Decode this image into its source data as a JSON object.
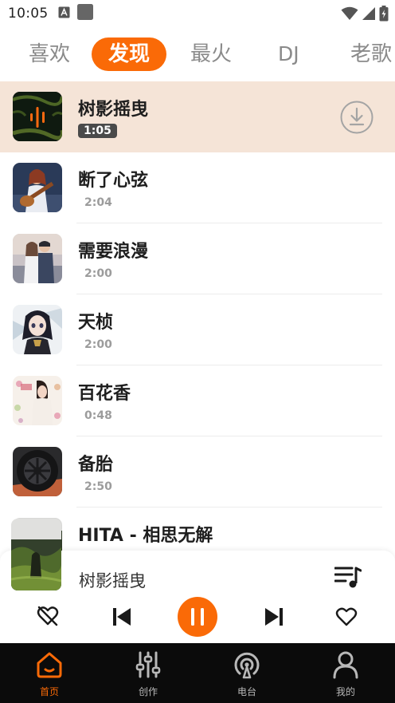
{
  "status": {
    "time": "10:05"
  },
  "tabs": [
    {
      "label": "喜欢",
      "active": false
    },
    {
      "label": "发现",
      "active": true
    },
    {
      "label": "最火",
      "active": false
    },
    {
      "label": "DJ",
      "active": false
    },
    {
      "label": "老歌",
      "active": false
    }
  ],
  "songs": [
    {
      "title": "树影摇曳",
      "duration": "1:05",
      "current": true,
      "cover_icon": "audio-wave-icon"
    },
    {
      "title": "断了心弦",
      "duration": "2:04",
      "current": false,
      "cover_icon": "guitar-girl-cover"
    },
    {
      "title": "需要浪漫",
      "duration": "2:00",
      "current": false,
      "cover_icon": "couple-cover"
    },
    {
      "title": "天桢",
      "duration": "2:00",
      "current": false,
      "cover_icon": "anime-girl-cover"
    },
    {
      "title": "百花香",
      "duration": "0:48",
      "current": false,
      "cover_icon": "flower-woman-cover"
    },
    {
      "title": "备胎",
      "duration": "2:50",
      "current": false,
      "cover_icon": "tire-cover"
    },
    {
      "title": "HITA - 相思无解",
      "duration": "",
      "current": false,
      "cover_icon": "forest-cover"
    }
  ],
  "player": {
    "title": "树影摇曳"
  },
  "nav": [
    {
      "label": "首页",
      "icon": "home-icon",
      "active": true
    },
    {
      "label": "创作",
      "icon": "sliders-icon",
      "active": false
    },
    {
      "label": "电台",
      "icon": "radio-icon",
      "active": false
    },
    {
      "label": "我的",
      "icon": "user-icon",
      "active": false
    }
  ],
  "colors": {
    "accent": "#fa6a07",
    "current_row": "#f5e4d7",
    "nav_bg": "#0b0b0b"
  }
}
